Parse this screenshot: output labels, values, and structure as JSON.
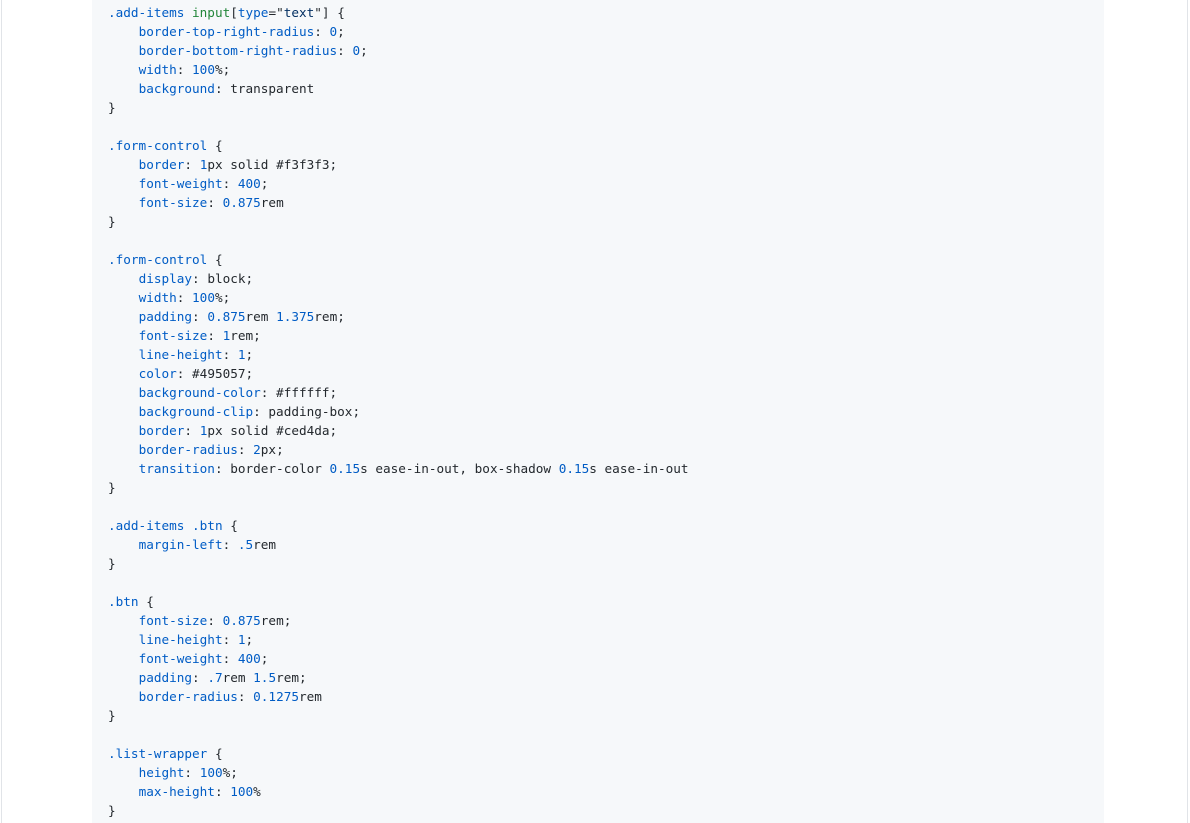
{
  "colors": {
    "code_background": "#f6f8fa",
    "selector": "#005cc5",
    "tag": "#22863a",
    "property": "#005cc5",
    "number": "#005cc5",
    "plain": "#24292e"
  },
  "code_lines": [
    [
      [
        "t-sel",
        ".add-items"
      ],
      [
        "t-plain",
        " "
      ],
      [
        "t-tag",
        "input"
      ],
      [
        "t-plain",
        "["
      ],
      [
        "t-sel",
        "type"
      ],
      [
        "t-plain",
        "=\""
      ],
      [
        "t-str",
        "text"
      ],
      [
        "t-plain",
        "\"] {"
      ]
    ],
    [
      [
        "t-plain",
        "    "
      ],
      [
        "t-prop",
        "border-top-right-radius"
      ],
      [
        "t-plain",
        ": "
      ],
      [
        "t-num",
        "0"
      ],
      [
        "t-plain",
        ";"
      ]
    ],
    [
      [
        "t-plain",
        "    "
      ],
      [
        "t-prop",
        "border-bottom-right-radius"
      ],
      [
        "t-plain",
        ": "
      ],
      [
        "t-num",
        "0"
      ],
      [
        "t-plain",
        ";"
      ]
    ],
    [
      [
        "t-plain",
        "    "
      ],
      [
        "t-prop",
        "width"
      ],
      [
        "t-plain",
        ": "
      ],
      [
        "t-num",
        "100"
      ],
      [
        "t-plain",
        "%;"
      ]
    ],
    [
      [
        "t-plain",
        "    "
      ],
      [
        "t-prop",
        "background"
      ],
      [
        "t-plain",
        ": transparent"
      ]
    ],
    [
      [
        "t-plain",
        "}"
      ]
    ],
    [],
    [
      [
        "t-sel",
        ".form-control"
      ],
      [
        "t-plain",
        " {"
      ]
    ],
    [
      [
        "t-plain",
        "    "
      ],
      [
        "t-prop",
        "border"
      ],
      [
        "t-plain",
        ": "
      ],
      [
        "t-num",
        "1"
      ],
      [
        "t-plain",
        "px solid #f3f3f3;"
      ]
    ],
    [
      [
        "t-plain",
        "    "
      ],
      [
        "t-prop",
        "font-weight"
      ],
      [
        "t-plain",
        ": "
      ],
      [
        "t-num",
        "400"
      ],
      [
        "t-plain",
        ";"
      ]
    ],
    [
      [
        "t-plain",
        "    "
      ],
      [
        "t-prop",
        "font-size"
      ],
      [
        "t-plain",
        ": "
      ],
      [
        "t-num",
        "0.875"
      ],
      [
        "t-plain",
        "rem"
      ]
    ],
    [
      [
        "t-plain",
        "}"
      ]
    ],
    [],
    [
      [
        "t-sel",
        ".form-control"
      ],
      [
        "t-plain",
        " {"
      ]
    ],
    [
      [
        "t-plain",
        "    "
      ],
      [
        "t-prop",
        "display"
      ],
      [
        "t-plain",
        ": block;"
      ]
    ],
    [
      [
        "t-plain",
        "    "
      ],
      [
        "t-prop",
        "width"
      ],
      [
        "t-plain",
        ": "
      ],
      [
        "t-num",
        "100"
      ],
      [
        "t-plain",
        "%;"
      ]
    ],
    [
      [
        "t-plain",
        "    "
      ],
      [
        "t-prop",
        "padding"
      ],
      [
        "t-plain",
        ": "
      ],
      [
        "t-num",
        "0.875"
      ],
      [
        "t-plain",
        "rem "
      ],
      [
        "t-num",
        "1.375"
      ],
      [
        "t-plain",
        "rem;"
      ]
    ],
    [
      [
        "t-plain",
        "    "
      ],
      [
        "t-prop",
        "font-size"
      ],
      [
        "t-plain",
        ": "
      ],
      [
        "t-num",
        "1"
      ],
      [
        "t-plain",
        "rem;"
      ]
    ],
    [
      [
        "t-plain",
        "    "
      ],
      [
        "t-prop",
        "line-height"
      ],
      [
        "t-plain",
        ": "
      ],
      [
        "t-num",
        "1"
      ],
      [
        "t-plain",
        ";"
      ]
    ],
    [
      [
        "t-plain",
        "    "
      ],
      [
        "t-prop",
        "color"
      ],
      [
        "t-plain",
        ": #495057;"
      ]
    ],
    [
      [
        "t-plain",
        "    "
      ],
      [
        "t-prop",
        "background-color"
      ],
      [
        "t-plain",
        ": #ffffff;"
      ]
    ],
    [
      [
        "t-plain",
        "    "
      ],
      [
        "t-prop",
        "background-clip"
      ],
      [
        "t-plain",
        ": padding-box;"
      ]
    ],
    [
      [
        "t-plain",
        "    "
      ],
      [
        "t-prop",
        "border"
      ],
      [
        "t-plain",
        ": "
      ],
      [
        "t-num",
        "1"
      ],
      [
        "t-plain",
        "px solid #ced4da;"
      ]
    ],
    [
      [
        "t-plain",
        "    "
      ],
      [
        "t-prop",
        "border-radius"
      ],
      [
        "t-plain",
        ": "
      ],
      [
        "t-num",
        "2"
      ],
      [
        "t-plain",
        "px;"
      ]
    ],
    [
      [
        "t-plain",
        "    "
      ],
      [
        "t-prop",
        "transition"
      ],
      [
        "t-plain",
        ": border-color "
      ],
      [
        "t-num",
        "0.15"
      ],
      [
        "t-plain",
        "s ease-in-out, box-shadow "
      ],
      [
        "t-num",
        "0.15"
      ],
      [
        "t-plain",
        "s ease-in-out"
      ]
    ],
    [
      [
        "t-plain",
        "}"
      ]
    ],
    [],
    [
      [
        "t-sel",
        ".add-items"
      ],
      [
        "t-plain",
        " "
      ],
      [
        "t-sel",
        ".btn"
      ],
      [
        "t-plain",
        " {"
      ]
    ],
    [
      [
        "t-plain",
        "    "
      ],
      [
        "t-prop",
        "margin-left"
      ],
      [
        "t-plain",
        ": "
      ],
      [
        "t-num",
        ".5"
      ],
      [
        "t-plain",
        "rem"
      ]
    ],
    [
      [
        "t-plain",
        "}"
      ]
    ],
    [],
    [
      [
        "t-sel",
        ".btn"
      ],
      [
        "t-plain",
        " {"
      ]
    ],
    [
      [
        "t-plain",
        "    "
      ],
      [
        "t-prop",
        "font-size"
      ],
      [
        "t-plain",
        ": "
      ],
      [
        "t-num",
        "0.875"
      ],
      [
        "t-plain",
        "rem;"
      ]
    ],
    [
      [
        "t-plain",
        "    "
      ],
      [
        "t-prop",
        "line-height"
      ],
      [
        "t-plain",
        ": "
      ],
      [
        "t-num",
        "1"
      ],
      [
        "t-plain",
        ";"
      ]
    ],
    [
      [
        "t-plain",
        "    "
      ],
      [
        "t-prop",
        "font-weight"
      ],
      [
        "t-plain",
        ": "
      ],
      [
        "t-num",
        "400"
      ],
      [
        "t-plain",
        ";"
      ]
    ],
    [
      [
        "t-plain",
        "    "
      ],
      [
        "t-prop",
        "padding"
      ],
      [
        "t-plain",
        ": "
      ],
      [
        "t-num",
        ".7"
      ],
      [
        "t-plain",
        "rem "
      ],
      [
        "t-num",
        "1.5"
      ],
      [
        "t-plain",
        "rem;"
      ]
    ],
    [
      [
        "t-plain",
        "    "
      ],
      [
        "t-prop",
        "border-radius"
      ],
      [
        "t-plain",
        ": "
      ],
      [
        "t-num",
        "0.1275"
      ],
      [
        "t-plain",
        "rem"
      ]
    ],
    [
      [
        "t-plain",
        "}"
      ]
    ],
    [],
    [
      [
        "t-sel",
        ".list-wrapper"
      ],
      [
        "t-plain",
        " {"
      ]
    ],
    [
      [
        "t-plain",
        "    "
      ],
      [
        "t-prop",
        "height"
      ],
      [
        "t-plain",
        ": "
      ],
      [
        "t-num",
        "100"
      ],
      [
        "t-plain",
        "%;"
      ]
    ],
    [
      [
        "t-plain",
        "    "
      ],
      [
        "t-prop",
        "max-height"
      ],
      [
        "t-plain",
        ": "
      ],
      [
        "t-num",
        "100"
      ],
      [
        "t-plain",
        "%"
      ]
    ],
    [
      [
        "t-plain",
        "}"
      ]
    ]
  ]
}
